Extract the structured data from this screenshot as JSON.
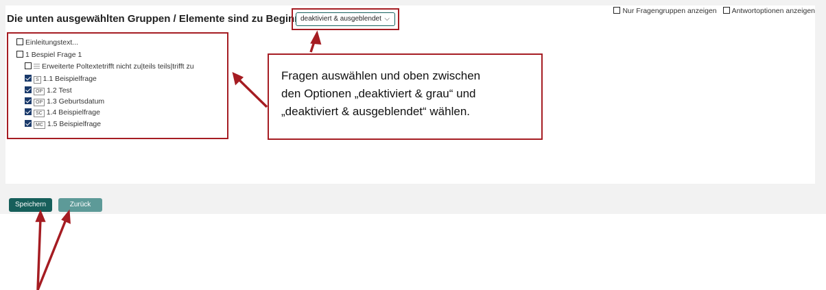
{
  "header": {
    "title": "Die unten ausgewählten Gruppen / Elemente sind zu Beginn",
    "mode_select_value": "deaktiviert & ausgeblendet",
    "filter_only_groups": "Nur Fragengruppen anzeigen",
    "filter_answer_options": "Antwortoptionen anzeigen"
  },
  "tree": {
    "intro": "Einleitungstext...",
    "group": "1 Bespiel Frage 1",
    "items": [
      {
        "badge": "",
        "label": "Erweiterte Poltextetrifft nicht zu|teils teils|trifft zu",
        "checked": false
      },
      {
        "badge": "S",
        "label": "1.1 Beispielfrage",
        "checked": true
      },
      {
        "badge": "OP",
        "label": "1.2 Test",
        "checked": true
      },
      {
        "badge": "OP",
        "label": "1.3 Geburtsdatum",
        "checked": true
      },
      {
        "badge": "SC",
        "label": "1.4 Beispielfrage",
        "checked": true
      },
      {
        "badge": "MC",
        "label": "1.5 Beispielfrage",
        "checked": true
      }
    ]
  },
  "callout": {
    "line1": "Fragen auswählen und oben zwischen",
    "line2": "den Optionen „deaktiviert & grau“ und",
    "line3": "„deaktiviert & ausgeblendet“ wählen."
  },
  "buttons": {
    "save": "Speichern",
    "back": "Zurück"
  },
  "colors": {
    "annotation": "#a51c22",
    "primary": "#175f5b",
    "secondary": "#5d9a98"
  }
}
